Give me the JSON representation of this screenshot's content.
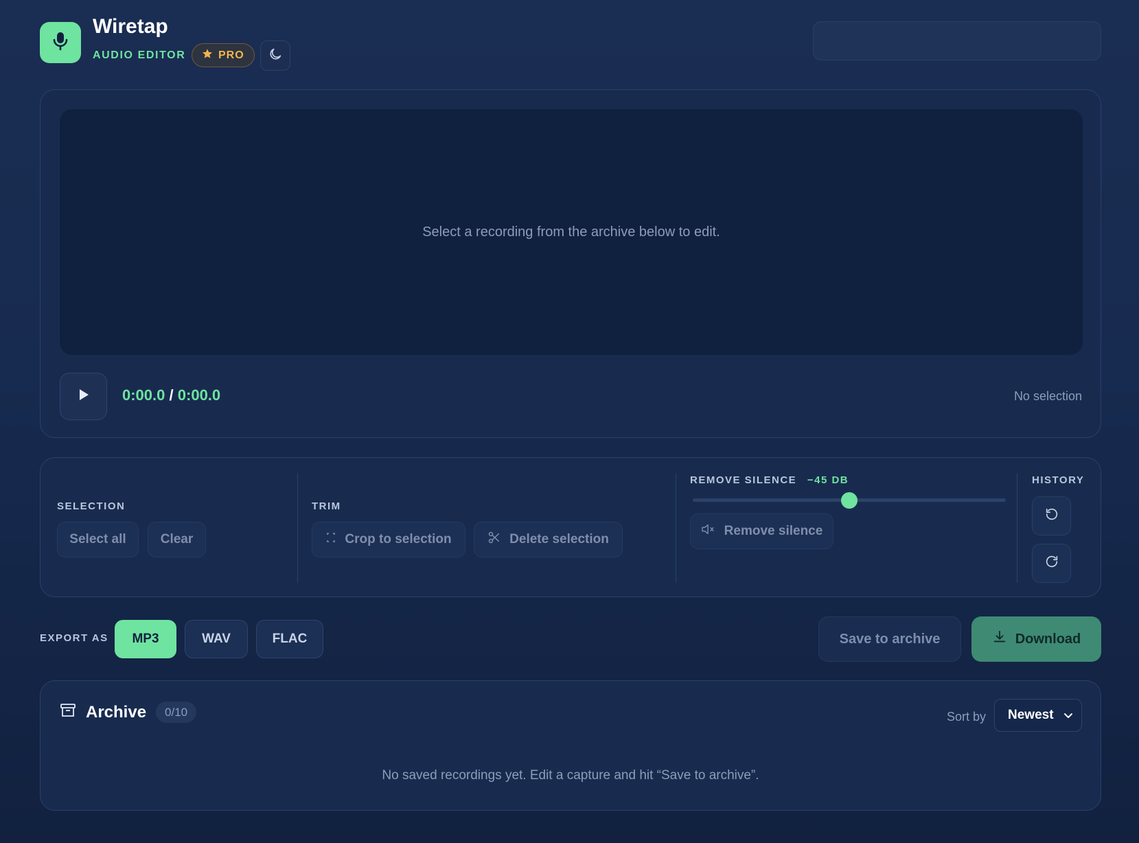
{
  "header": {
    "title": "Wiretap",
    "subtitle": "AUDIO EDITOR",
    "badge": "PRO",
    "logo_icon": "microphone-icon",
    "theme_icon": "moon-icon"
  },
  "editor": {
    "empty_message": "Select a recording from the archive below to edit.",
    "current_time": "0:00.0",
    "separator": "/",
    "total_time": "0:00.0",
    "selection_status": "No selection"
  },
  "tools": {
    "selection": {
      "label": "SELECTION",
      "select_all": "Select all",
      "clear": "Clear"
    },
    "trim": {
      "label": "TRIM",
      "crop": "Crop to selection",
      "delete": "Delete selection"
    },
    "silence": {
      "label": "REMOVE SILENCE",
      "threshold_label": "−45 DB",
      "threshold_fraction": 0.5,
      "button": "Remove silence"
    },
    "history": {
      "label": "HISTORY",
      "undo_icon": "undo-icon",
      "redo_icon": "redo-icon"
    }
  },
  "export": {
    "label": "EXPORT AS",
    "formats": [
      "MP3",
      "WAV",
      "FLAC"
    ],
    "selected": "MP3",
    "save_label": "Save to archive",
    "download_label": "Download"
  },
  "archive": {
    "title": "Archive",
    "count": "0/10",
    "sort_label": "Sort by",
    "sort_value": "Newest",
    "empty_message": "No saved recordings yet. Edit a capture and hit “Save to archive”."
  },
  "colors": {
    "accent": "#6fe3a0",
    "badge_gold": "#f0b64d",
    "background": "#172a4f",
    "download_button": "#3f8a72"
  }
}
